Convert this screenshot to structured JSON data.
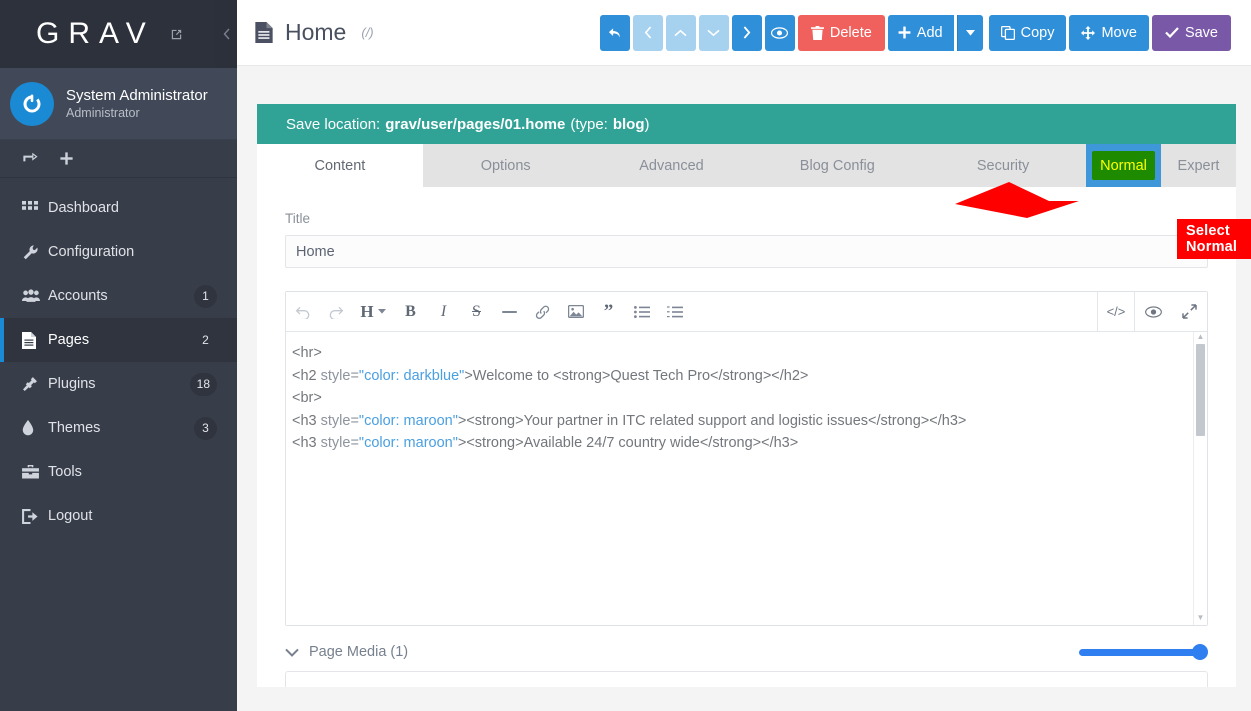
{
  "sidebar": {
    "brand": "GRAV",
    "brand_external_icon": "external-link-icon",
    "collapse_icon": "chevron-left-icon",
    "user": {
      "name": "System Administrator",
      "role": "Administrator",
      "avatar_icon": "grav-power-icon"
    },
    "quick_actions": [
      {
        "name": "sync-icon",
        "label": ""
      },
      {
        "name": "plus-icon",
        "label": ""
      }
    ],
    "items": [
      {
        "label": "Dashboard",
        "icon": "grid-icon",
        "badge": "",
        "active": false
      },
      {
        "label": "Configuration",
        "icon": "wrench-icon",
        "badge": "",
        "active": false
      },
      {
        "label": "Accounts",
        "icon": "users-icon",
        "badge": "1",
        "active": false
      },
      {
        "label": "Pages",
        "icon": "file-text-icon",
        "badge": "2",
        "active": true
      },
      {
        "label": "Plugins",
        "icon": "plug-icon",
        "badge": "18",
        "active": false
      },
      {
        "label": "Themes",
        "icon": "droplet-icon",
        "badge": "3",
        "active": false
      },
      {
        "label": "Tools",
        "icon": "toolbox-icon",
        "badge": "",
        "active": false
      },
      {
        "label": "Logout",
        "icon": "logout-icon",
        "badge": "",
        "active": false
      }
    ]
  },
  "header": {
    "page_icon": "file-text-icon",
    "title": "Home",
    "slug": "(/)",
    "buttons": [
      {
        "name": "back-button",
        "label": "",
        "icon": "undo-arrow-icon",
        "style": "blue-sq"
      },
      {
        "name": "prev-button",
        "label": "",
        "icon": "chevron-left-icon",
        "style": "faded-sq"
      },
      {
        "name": "up-button",
        "label": "",
        "icon": "chevron-up-icon",
        "style": "faded-sq"
      },
      {
        "name": "down-button",
        "label": "",
        "icon": "chevron-down-icon",
        "style": "faded-sq"
      },
      {
        "name": "next-button",
        "label": "",
        "icon": "chevron-right-icon",
        "style": "blue-sq"
      },
      {
        "name": "preview-button",
        "label": "",
        "icon": "eye-icon",
        "style": "blue-sq"
      },
      {
        "name": "delete-button",
        "label": "Delete",
        "icon": "trash-icon",
        "style": "red"
      },
      {
        "name": "add-button",
        "label": "Add",
        "icon": "plus-icon",
        "style": "blue-split"
      },
      {
        "name": "add-dropdown",
        "label": "",
        "icon": "caret-down-icon",
        "style": "blue-split-r"
      },
      {
        "name": "copy-button",
        "label": "Copy",
        "icon": "copy-icon",
        "style": "blue"
      },
      {
        "name": "move-button",
        "label": "Move",
        "icon": "move-icon",
        "style": "blue"
      },
      {
        "name": "save-button",
        "label": "Save",
        "icon": "check-icon",
        "style": "purple"
      }
    ]
  },
  "save_location": {
    "prefix": "Save location:",
    "path": "grav/user/pages/01.home",
    "type_prefix": "(type:",
    "type": "blog",
    "type_suffix": ")"
  },
  "tabs": {
    "items": [
      {
        "label": "Content",
        "active": true
      },
      {
        "label": "Options",
        "active": false
      },
      {
        "label": "Advanced",
        "active": false
      },
      {
        "label": "Blog Config",
        "active": false
      },
      {
        "label": "Security",
        "active": false
      }
    ],
    "modes": [
      {
        "label": "Normal",
        "selected": true
      },
      {
        "label": "Expert",
        "selected": false
      }
    ]
  },
  "form": {
    "title_label": "Title",
    "title_value": "Home",
    "title_placeholder": "Title"
  },
  "editor": {
    "toolbar_left": [
      {
        "name": "undo-icon",
        "glyph": "↺",
        "disabled": true
      },
      {
        "name": "redo-icon",
        "glyph": "↻",
        "disabled": true
      },
      {
        "name": "heading-icon",
        "glyph": "H",
        "disabled": false
      },
      {
        "name": "bold-icon",
        "glyph": "B",
        "disabled": false
      },
      {
        "name": "italic-icon",
        "glyph": "I",
        "disabled": false
      },
      {
        "name": "strikethrough-icon",
        "glyph": "S",
        "disabled": false
      },
      {
        "name": "horizontal-rule-icon",
        "glyph": "—",
        "disabled": false
      },
      {
        "name": "link-icon",
        "glyph": "🔗",
        "disabled": false
      },
      {
        "name": "image-icon",
        "glyph": "🖼",
        "disabled": false
      },
      {
        "name": "blockquote-icon",
        "glyph": "❞",
        "disabled": false
      },
      {
        "name": "bullet-list-icon",
        "glyph": "☰",
        "disabled": false
      },
      {
        "name": "numbered-list-icon",
        "glyph": "☰",
        "disabled": false
      }
    ],
    "toolbar_right": [
      {
        "name": "code-view-icon",
        "glyph": "</>"
      },
      {
        "name": "preview-eye-icon",
        "glyph": "👁"
      },
      {
        "name": "fullscreen-icon",
        "glyph": "⤢"
      }
    ],
    "lines": [
      [
        {
          "t": "<hr>",
          "c": "plain"
        }
      ],
      [
        {
          "t": "<h2 ",
          "c": "plain"
        },
        {
          "t": "style=",
          "c": "attr"
        },
        {
          "t": "\"color: darkblue\"",
          "c": "str"
        },
        {
          "t": ">Welcome to <strong>Quest Tech Pro</strong></h2>",
          "c": "plain"
        }
      ],
      [
        {
          "t": "<br>",
          "c": "plain"
        }
      ],
      [
        {
          "t": "<h3 ",
          "c": "plain"
        },
        {
          "t": "style=",
          "c": "attr"
        },
        {
          "t": "\"color: maroon\"",
          "c": "str"
        },
        {
          "t": "><strong>Your partner in ITC related support and logistic issues</strong></h3>",
          "c": "plain"
        }
      ],
      [
        {
          "t": "<h3 ",
          "c": "plain"
        },
        {
          "t": "style=",
          "c": "attr"
        },
        {
          "t": "\"color: maroon\"",
          "c": "str"
        },
        {
          "t": "><strong>Available 24/7 country wide</strong></h3>",
          "c": "plain"
        }
      ]
    ]
  },
  "page_media": {
    "toggle_icon": "chevron-down-icon",
    "label": "Page Media (1)",
    "slider_value": 100
  },
  "annotation": {
    "text": "Select Normal",
    "color": "#fe0000",
    "points_to": "Normal"
  },
  "colors": {
    "sidebar_bg": "#373d49",
    "sidebar_brand_bg": "#2d313c",
    "accent_blue": "#2f8fd8",
    "save_purple": "#7a58a8",
    "delete_red": "#f0605c",
    "teal": "#31a396",
    "mode_selected_bg": "#3e97d8",
    "mode_highlight_bg": "#1d8a00",
    "mode_highlight_text": "#ffff00",
    "annotation_red": "#fe0000"
  }
}
